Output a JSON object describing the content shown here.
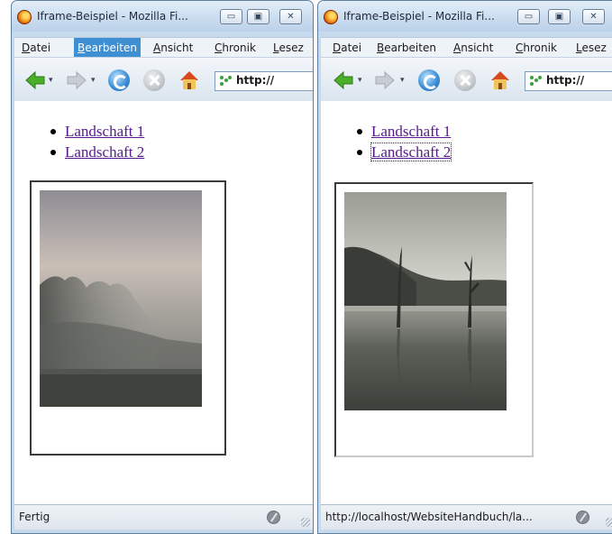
{
  "windows": [
    {
      "title": "Iframe-Beispiel - Mozilla Fi...",
      "menu": [
        {
          "underline": "D",
          "rest": "atei",
          "active": false
        },
        {
          "underline": "B",
          "rest": "earbeiten",
          "active": true
        },
        {
          "underline": "A",
          "rest": "nsicht",
          "active": false
        },
        {
          "underline": "C",
          "rest": "hronik",
          "active": false
        },
        {
          "underline": "L",
          "rest": "esez",
          "active": false
        }
      ],
      "url": "http://",
      "links": [
        "Landschaft 1",
        "Landschaft 2"
      ],
      "status": "Fertig",
      "iframe_image": "misty-forest-landscape"
    },
    {
      "title": "Iframe-Beispiel - Mozilla Fi...",
      "menu": [
        {
          "underline": "D",
          "rest": "atei",
          "active": false
        },
        {
          "underline": "B",
          "rest": "earbeiten",
          "active": false
        },
        {
          "underline": "A",
          "rest": "nsicht",
          "active": false
        },
        {
          "underline": "C",
          "rest": "hronik",
          "active": false
        },
        {
          "underline": "L",
          "rest": "esez",
          "active": false
        }
      ],
      "url": "http://",
      "links": [
        "Landschaft 1",
        "Landschaft 2"
      ],
      "status": "http://localhost/WebsiteHandbuch/la...",
      "iframe_image": "lake-with-dead-trees-landscape"
    }
  ],
  "icons": {
    "back": "back-arrow-icon",
    "forward": "forward-arrow-icon",
    "reload": "reload-icon",
    "stop": "stop-icon",
    "home": "home-icon",
    "site": "site-identity-icon",
    "status": "connection-status-icon"
  },
  "colors": {
    "chrome": "#c7d9ec",
    "menu_active": "#3f8fd3",
    "link": "#551a8b"
  }
}
